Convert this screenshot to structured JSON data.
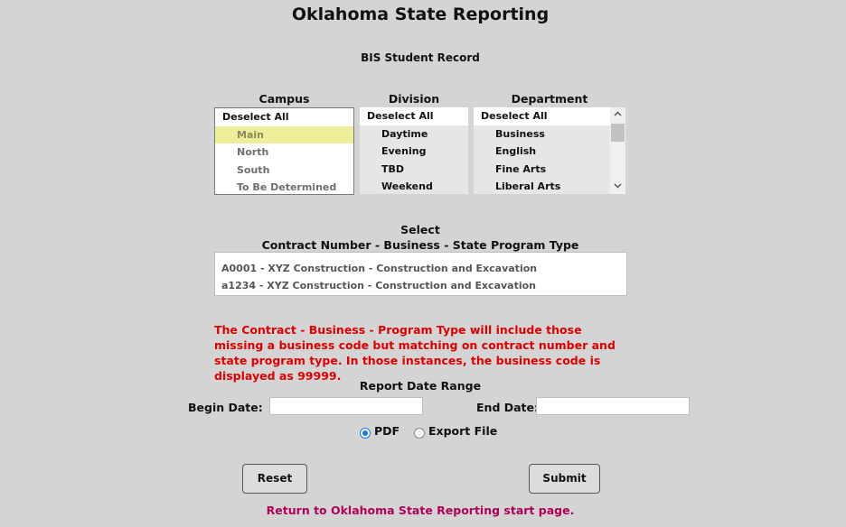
{
  "page": {
    "title": "Oklahoma State Reporting",
    "subtitle": "BIS Student Record"
  },
  "campus": {
    "header": "Campus",
    "deselect": "Deselect All",
    "items": [
      "Main",
      "North",
      "South",
      "To Be Determined"
    ],
    "selected": "Main"
  },
  "division": {
    "header": "Division",
    "deselect": "Deselect All",
    "items": [
      "Daytime",
      "Evening",
      "TBD",
      "Weekend"
    ]
  },
  "department": {
    "header": "Department",
    "deselect": "Deselect All",
    "items": [
      "Business",
      "English",
      "Fine Arts",
      "Liberal Arts"
    ],
    "scroll_up_icon": "chevron-up-icon",
    "scroll_down_icon": "chevron-down-icon"
  },
  "contract": {
    "select_label": "Select",
    "header": "Contract Number - Business - State Program Type",
    "items": [
      "A0001 - XYZ Construction - Construction and Excavation",
      "a1234 - XYZ Construction - Construction and Excavation"
    ]
  },
  "notice": {
    "text": "The Contract - Business - Program Type will include those missing a business code but matching on contract number and state program type. In those instances, the business code is displayed as 99999.",
    "color": "#e00000"
  },
  "date_range": {
    "header": "Report Date Range",
    "begin_label": "Begin Date:",
    "begin_value": "",
    "end_label": "End Date:",
    "end_value": ""
  },
  "output": {
    "pdf_label": "PDF",
    "export_label": "Export File",
    "selected": "PDF"
  },
  "buttons": {
    "reset": "Reset",
    "submit": "Submit"
  },
  "footer": {
    "link_text": "Return to Oklahoma State Reporting start page.",
    "link_color": "#b0005a"
  }
}
